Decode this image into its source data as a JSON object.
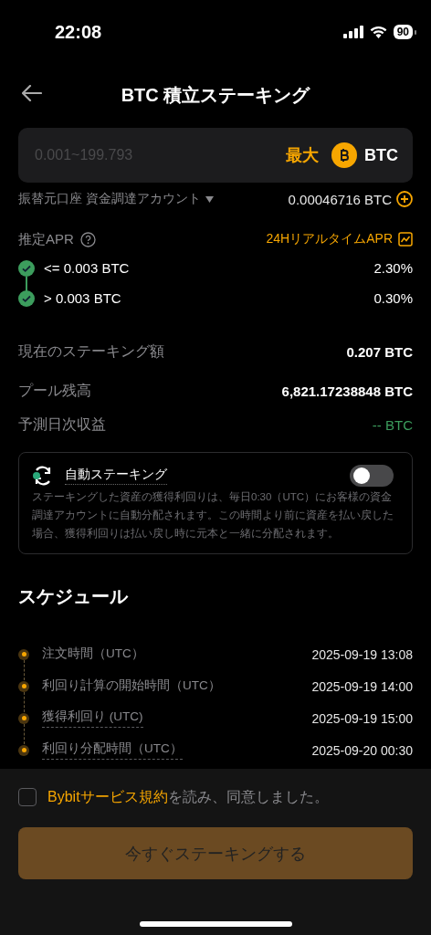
{
  "status_bar": {
    "time": "22:08",
    "battery": "90"
  },
  "header": {
    "title": "BTC 積立ステーキング"
  },
  "amount_input": {
    "placeholder": "0.001~199.793",
    "max_label": "最大",
    "coin": "BTC"
  },
  "account": {
    "label": "振替元口座 資金調達アカウント",
    "balance": "0.00046716 BTC"
  },
  "apr": {
    "label": "推定APR",
    "link": "24HリアルタイムAPR",
    "tiers": [
      {
        "range": "<= 0.003  BTC",
        "rate": "2.30%"
      },
      {
        "range": "> 0.003  BTC",
        "rate": "0.30%"
      }
    ]
  },
  "stats": [
    {
      "label": "現在のステーキング額",
      "value": "0.207 BTC",
      "kind": "amount"
    },
    {
      "label": "プール残高",
      "value": "6,821.17238848 BTC",
      "kind": "amount"
    },
    {
      "label": "予測日次収益",
      "value": "-- BTC",
      "kind": "estimate"
    }
  ],
  "auto_staking": {
    "title": "自動ステーキング",
    "on": false,
    "description": "ステーキングした資産の獲得利回りは、毎日0:30（UTC）にお客様の資金調達アカウントに自動分配されます。この時間より前に資産を払い戻した場合、獲得利回りは払い戻し時に元本と一緒に分配されます。"
  },
  "schedule": {
    "title": "スケジュール",
    "items": [
      {
        "label": "注文時間（UTC）",
        "time": "2025-09-19 13:08",
        "tooltip": false
      },
      {
        "label": "利回り計算の開始時間（UTC）",
        "time": "2025-09-19 14:00",
        "tooltip": false
      },
      {
        "label": "獲得利回り (UTC)",
        "time": "2025-09-19 15:00",
        "tooltip": true
      },
      {
        "label": "利回り分配時間（UTC）",
        "time": "2025-09-20 00:30",
        "tooltip": true
      }
    ]
  },
  "agreement": {
    "checked": false,
    "link": "Bybitサービス規約",
    "text": "を読み、同意しました。"
  },
  "submit_button": "今すぐステーキングする"
}
